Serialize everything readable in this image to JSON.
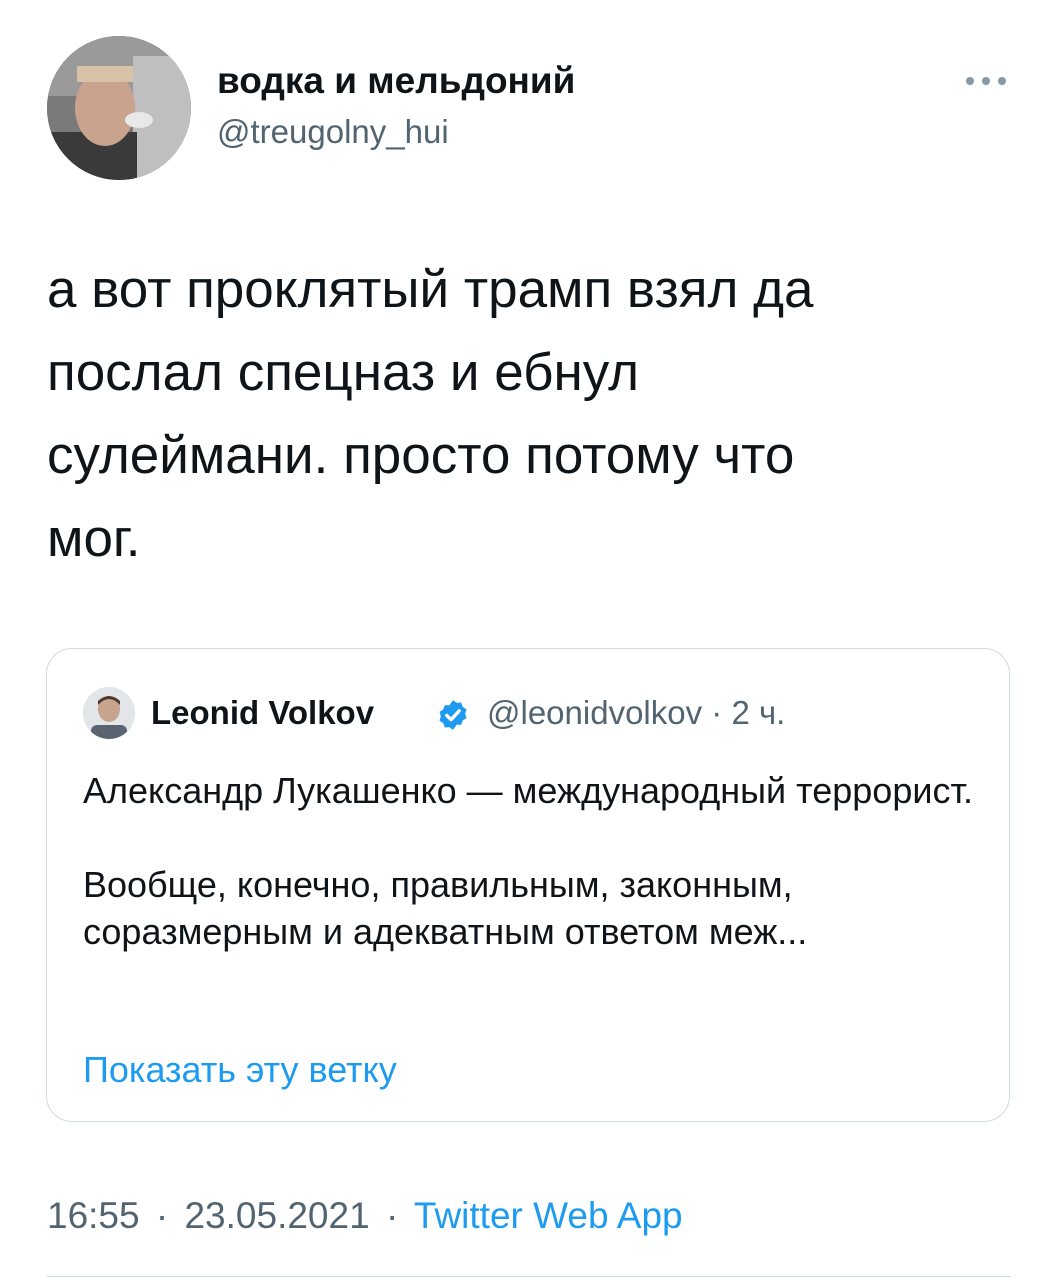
{
  "tweet": {
    "author": {
      "display_name": "водка и мельдоний",
      "handle": "@treugolny_hui",
      "avatar_icon": "avatar-photo"
    },
    "more_icon": "more-horizontal-icon",
    "text": "а вот проклятый трамп взял да\nпослал спецназ и ебнул\nсулеймани. просто потому что\nмог.",
    "quote": {
      "author": {
        "display_name": "Leonid Volkov",
        "handle": "@leonidvolkov",
        "time": "2 ч.",
        "verified_icon": "verified-badge-icon"
      },
      "text_p1": "Александр Лукашенко — международный террорист.",
      "text_p2": "Вообще, конечно, правильным, законным, соразмерным и адекватным ответом меж...",
      "show_thread": "Показать эту ветку"
    },
    "footer": {
      "time": "16:55",
      "date": "23.05.2021",
      "separator": "·",
      "source": "Twitter Web App"
    }
  },
  "colors": {
    "text": "#0f1419",
    "secondary": "#536471",
    "accent": "#1d9bf0",
    "border": "#cfd9de"
  }
}
